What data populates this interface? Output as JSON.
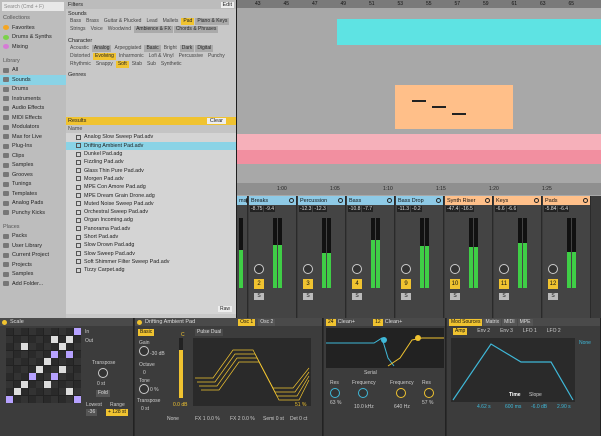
{
  "browser": {
    "search_placeholder": "Search (Cmd + F)",
    "collections_title": "Collections",
    "collections": [
      {
        "label": "Favorites",
        "color": "#f5a623"
      },
      {
        "label": "Drums & Synths",
        "color": "#7bd24a"
      },
      {
        "label": "Mixing",
        "color": "#d67bd6"
      }
    ],
    "library_title": "Library",
    "library": [
      "All",
      "Sounds",
      "Drums",
      "Instruments",
      "Audio Effects",
      "MIDI Effects",
      "Modulators",
      "Max for Live",
      "Plug-Ins",
      "Clips",
      "Samples",
      "Grooves",
      "Tunings",
      "Templates",
      "Analog Pads",
      "Punchy Kicks"
    ],
    "places_title": "Places",
    "places": [
      "Packs",
      "User Library",
      "Current Project",
      "Projects",
      "Samples",
      "Add Folder..."
    ],
    "filters_label": "Filters",
    "edit_label": "Edit",
    "sounds_label": "Sounds",
    "sounds_chips": [
      {
        "label": "Bass",
        "on": false
      },
      {
        "label": "Brass",
        "on": false
      },
      {
        "label": "Guitar & Plucked",
        "on": false
      },
      {
        "label": "Lead",
        "on": false
      },
      {
        "label": "Mallets",
        "on": false
      },
      {
        "label": "Pad",
        "on": true
      },
      {
        "label": "Piano & Keys",
        "on": false,
        "dark": true
      },
      {
        "label": "Strings",
        "on": false
      },
      {
        "label": "Voice",
        "on": false
      },
      {
        "label": "Woodwind",
        "on": false
      },
      {
        "label": "Ambience & FX",
        "on": false,
        "dark": true
      },
      {
        "label": "Chords & Phrases",
        "on": false,
        "dark": true
      }
    ],
    "character_label": "Character",
    "character_chips": [
      {
        "label": "Acoustic",
        "on": false
      },
      {
        "label": "Analog",
        "on": false,
        "dark": true
      },
      {
        "label": "Arpeggiated",
        "on": false
      },
      {
        "label": "Basic",
        "on": false,
        "dark": true
      },
      {
        "label": "Bright",
        "on": false
      },
      {
        "label": "Dark",
        "on": false,
        "dark": true
      },
      {
        "label": "Digital",
        "on": false,
        "dark": true
      },
      {
        "label": "Distorted",
        "on": false
      },
      {
        "label": "Evolving",
        "on": true
      },
      {
        "label": "Inharmonic",
        "on": false
      },
      {
        "label": "Lofi & Vinyl",
        "on": false
      },
      {
        "label": "Percussive",
        "on": false
      },
      {
        "label": "Punchy",
        "on": false
      },
      {
        "label": "Rhythmic",
        "on": false
      },
      {
        "label": "Snappy",
        "on": false
      },
      {
        "label": "Soft",
        "on": true
      },
      {
        "label": "Stab",
        "on": false
      },
      {
        "label": "Sub",
        "on": false
      },
      {
        "label": "Synthetic",
        "on": false
      }
    ],
    "genres_label": "Genres",
    "results_label": "Results",
    "clear_label": "Clear",
    "name_header": "Name",
    "results": [
      "Analog Slow Sweep Pad.adv",
      "Drifting Ambient Pad.adv",
      "Dunkel Pad.adg",
      "Fizzling Pad.adv",
      "Glass Thin Pure Pad.adv",
      "Morgen Pad.adv",
      "MPE Con Amore Pad.adg",
      "MPE Dream Grain Drone.adg",
      "Muted Noise Sweep Pad.adv",
      "Orchestral Sweep Pad.adv",
      "Organ Incoming.adg",
      "Panorama Pad.adv",
      "Short Pad.adv",
      "Slow Drown Pad.adg",
      "Slow Sweep Pad.adv",
      "Soft Shimmer Filter Sweep Pad.adv",
      "Tizzy Carpet.adg"
    ],
    "selected_result": 1,
    "raw_label": "Raw"
  },
  "arrangement": {
    "bars": [
      "43",
      "45",
      "47",
      "49",
      "51",
      "53",
      "55",
      "57",
      "59",
      "61",
      "63",
      "65"
    ],
    "times": [
      "1:00",
      "1:05",
      "1:10",
      "1:15",
      "1:20",
      "1:25"
    ]
  },
  "mixer": {
    "tracks": [
      {
        "name": "ms",
        "color": "#8ecae6",
        "v1": "",
        "v2": "",
        "num": "1",
        "level": 0.55
      },
      {
        "name": "Breaks",
        "color": "#8ecae6",
        "v1": "-8.75",
        "v2": "-9.4",
        "num": "2",
        "level": 0.62
      },
      {
        "name": "Percussion",
        "color": "#8ecae6",
        "v1": "-12.3",
        "v2": "-12.3",
        "num": "3",
        "level": 0.5
      },
      {
        "name": "Bass",
        "color": "#8ecae6",
        "v1": "-10.8",
        "v2": "-7.7",
        "num": "4",
        "level": 0.68
      },
      {
        "name": "Bass Drop",
        "color": "#8ecae6",
        "v1": "-11.3",
        "v2": "-0.2",
        "num": "9",
        "level": 0.6
      },
      {
        "name": "Synth Riser",
        "color": "#ffc08a",
        "v1": "-47.4",
        "v2": "-16.5",
        "num": "10",
        "level": 0.58
      },
      {
        "name": "Keys",
        "color": "#ffc08a",
        "v1": "-6.6",
        "v2": "-6.6",
        "num": "11",
        "level": 0.64
      },
      {
        "name": "Pads",
        "color": "#ffc08a",
        "v1": "-5.84",
        "v2": "-6.4",
        "num": "12",
        "level": 0.52
      }
    ]
  },
  "devices": {
    "scale": {
      "title": "Scale",
      "in_label": "In",
      "out_label": "Out",
      "transpose_label": "Transpose",
      "transpose_value": "0 st",
      "fold_label": "Fold",
      "lowest_label": "Lowest",
      "range_label": "Range",
      "range_value": "+ 128 st",
      "lowest_value": "-36"
    },
    "instrument": {
      "title": "Drifting Ambient Pad",
      "osc_tab1": "Osc 1",
      "osc_tab2": "Osc 2",
      "basic_label": "Basic",
      "wave_label": "Pulse Dual",
      "gain_label": "Gain",
      "gain_value": "-30 dB",
      "octave_label": "Octave",
      "octave_value": "0",
      "tone_label": "Tone",
      "tone_value": "0 %",
      "transpose_label": "Transpose",
      "transpose_value": "0 st",
      "level_value": "0.0 dB",
      "c_label": "C",
      "none_label": "None",
      "fx1": "FX 1 0.0 %",
      "fx2": "FX 2 0.0 %",
      "semi": "Semi 0 st",
      "detune": "Det 0 ct",
      "pct": "51 %"
    },
    "filter": {
      "clean1": "Clean+",
      "clean2": "Clean+",
      "num1": "24",
      "num2": "12",
      "serial_label": "Serial",
      "res1_label": "Res",
      "res1_value": "63 %",
      "freq1_label": "Frequency",
      "freq1_value": "10.0 kHz",
      "freq2_label": "Frequency",
      "freq2_value": "640 Hz",
      "res2_label": "Res",
      "res2_value": "57 %"
    },
    "mod": {
      "tabs": [
        "Mod Sources",
        "Matrix",
        "MIDI",
        "MPE"
      ],
      "amp_tab": "Amp",
      "env2": "Env 2",
      "env3": "Env 3",
      "lfo1": "LFO 1",
      "lfo2": "LFO 2",
      "time_label": "Time",
      "slope_label": "Slope",
      "a_val": "4.62 s",
      "d_val": "600 ms",
      "s_val": "-6.0 dB",
      "r_val": "2.90 s",
      "none_label": "None"
    }
  }
}
